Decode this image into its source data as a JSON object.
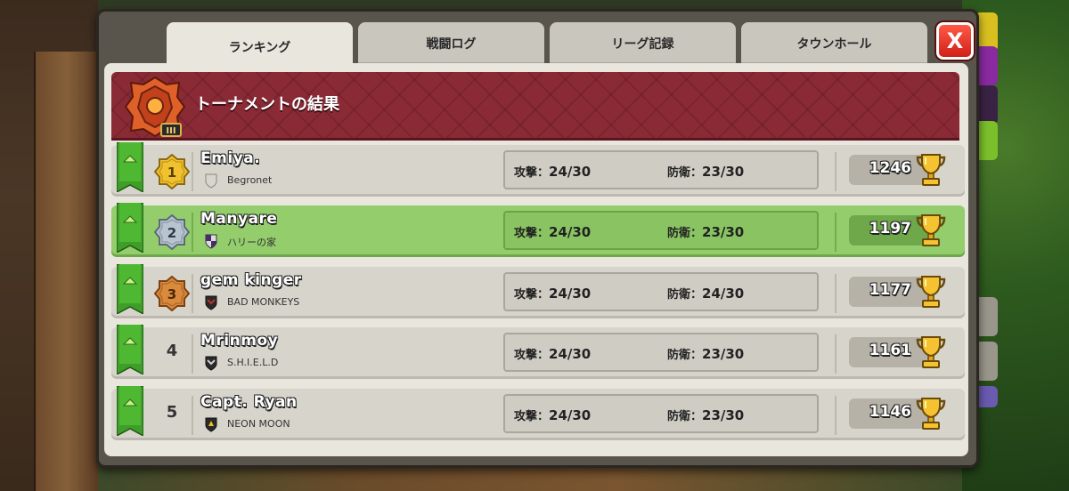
{
  "tabs": [
    {
      "label": "ランキング",
      "active": true
    },
    {
      "label": "戦闘ログ",
      "active": false
    },
    {
      "label": "リーグ記録",
      "active": false
    },
    {
      "label": "タウンホール",
      "active": false
    }
  ],
  "close_label": "X",
  "header": {
    "title": "トーナメントの結果",
    "league_badge_icon": "tournament-league-badge",
    "league_tier": "III"
  },
  "labels": {
    "attack": "攻撃：",
    "defense": "防衛："
  },
  "rows": [
    {
      "rank": "1",
      "name": "Emiya.",
      "clan": "Begronet",
      "attack": "24/30",
      "defense": "23/30",
      "trophies": "1246",
      "highlight": false,
      "clan_icon": "gray-shield"
    },
    {
      "rank": "2",
      "name": "Manyare",
      "clan": "ハリーの家",
      "attack": "24/30",
      "defense": "23/30",
      "trophies": "1197",
      "highlight": true,
      "clan_icon": "checker-shield"
    },
    {
      "rank": "3",
      "name": "gem kinger",
      "clan": "BAD MONKEYS",
      "attack": "24/30",
      "defense": "24/30",
      "trophies": "1177",
      "highlight": false,
      "clan_icon": "red-dark-shield"
    },
    {
      "rank": "4",
      "name": "Mrinmoy",
      "clan": "S.H.I.E.L.D",
      "attack": "24/30",
      "defense": "23/30",
      "trophies": "1161",
      "highlight": false,
      "clan_icon": "chevron-shield"
    },
    {
      "rank": "5",
      "name": "Capt. Ryan",
      "clan": "NEON MOON",
      "attack": "24/30",
      "defense": "23/30",
      "trophies": "1146",
      "highlight": false,
      "clan_icon": "yellow-emblem-shield"
    }
  ],
  "colors": {
    "highlight_row": "#93cd6c",
    "banner": "#8a2a35",
    "ribbon": "#3f9d2a"
  }
}
